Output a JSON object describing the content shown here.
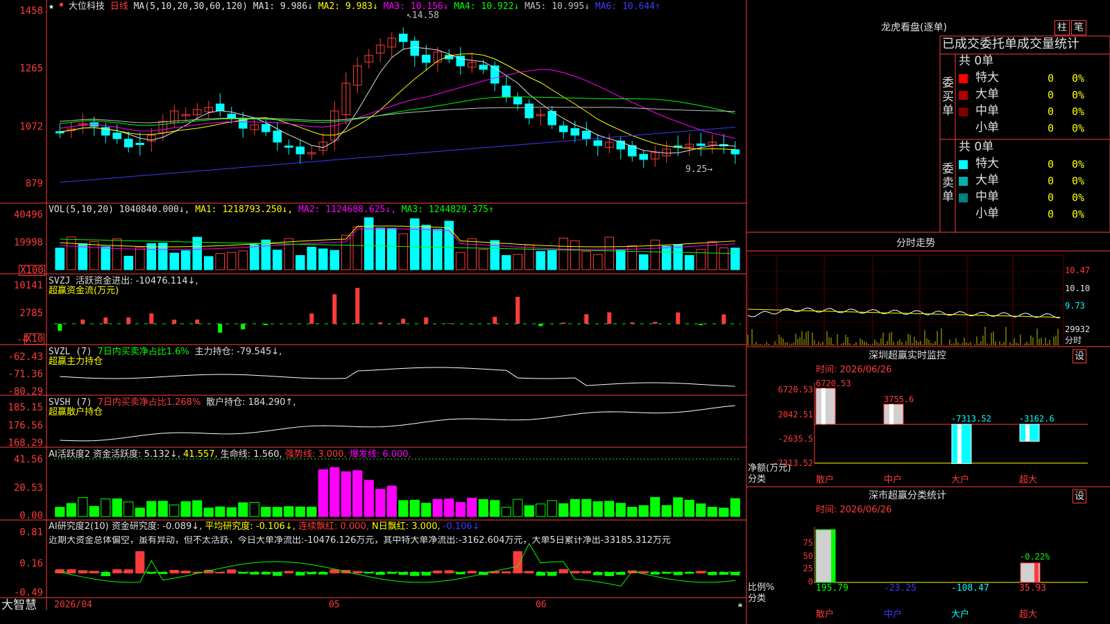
{
  "stock": {
    "name": "大位科技",
    "period": "日线"
  },
  "top_menu": {
    "star": "★",
    "circle": "●"
  },
  "kline": {
    "ma_title": "MA(5,10,20,30,60,120)",
    "ma_values": [
      {
        "label": "MA1: 9.986↓",
        "color": "#e0e0e0"
      },
      {
        "label": "MA2: 9.983↓",
        "color": "#ffff00"
      },
      {
        "label": "MA3: 10.156↓",
        "color": "#ff00ff"
      },
      {
        "label": "MA4: 10.922↓",
        "color": "#00ff00"
      },
      {
        "label": "MA5: 10.995↓",
        "color": "#c0c0c0"
      },
      {
        "label": "MA6: 10.644↑",
        "color": "#3b3bff"
      }
    ],
    "y_ticks": [
      "1458",
      "1265",
      "1072",
      "879"
    ],
    "high_marker": "14.58",
    "low_marker": "9.25"
  },
  "vol": {
    "title": "VOL(5,10,20)",
    "value": "1040840.000↓,",
    "ma1": "MA1: 1218793.250↓,",
    "ma2": "MA2: 1124688.625↓,",
    "ma3": "MA3: 1244829.375↑",
    "y_ticks": [
      "40496",
      "19998"
    ],
    "unit": "X100"
  },
  "svzj": {
    "title": "SVZJ",
    "label": "活跃资金进出: -10476.114↓,",
    "sub": "超赢资金流(万元)",
    "y_ticks": [
      "10141",
      "2785",
      "-4"
    ],
    "unit": "X10"
  },
  "svzl": {
    "title": "SVZL (7)",
    "red": "7日内买卖净占比1.6%",
    "label": "主力持仓: -79.545↓,",
    "sub": "超赢主力持仓",
    "y_ticks": [
      "-62.43",
      "-71.36",
      "-80.29"
    ]
  },
  "svsh": {
    "title": "SVSH (7)",
    "red": "7日内买卖净占比1.268%",
    "label": "散户持仓: 184.290↑,",
    "sub": "超赢散户持仓",
    "y_ticks": [
      "185.15",
      "176.56",
      "168.29"
    ]
  },
  "ai_active": {
    "title": "AI活跃度2 资金活跃度: 5.132↓,",
    "v2": "41.557,",
    "v3": "生命线: 1.560,",
    "v4": "强势线: 3.000,",
    "v5": "爆发线: 6.000,",
    "y_ticks": [
      "41.56",
      "20.53",
      "0.00"
    ]
  },
  "ai_research": {
    "title": "AI研究度2(10) 资金研究度: -0.089↓,",
    "v2": "平均研究度: -0.106↓,",
    "v3": "连续飘红: 0.000,",
    "v4": "N日飘红: 3.000,",
    "v5": "-0.106↓",
    "note": "近期大资金总体偏空，虽有异动，但不太活跃，今日大单净流出:-10476.126万元，其中特大单净流出:-3162.604万元，大单5日累计净出-33185.312万元",
    "y_ticks": [
      "0.81",
      "0.16",
      "-0.49"
    ]
  },
  "bottom": {
    "brand": "大智慧",
    "date": "2026/04",
    "m05": "05",
    "m06": "06"
  },
  "dragon": {
    "title": "龙虎看盘(逐单)",
    "tabs": [
      "柱",
      "笔"
    ],
    "header": "已成交委托单成交量统计",
    "buy_label": "委买单",
    "sell_label": "委卖单",
    "buy_total": "共 0单",
    "sell_total": "共 0单",
    "buy_rows": [
      {
        "name": "特大",
        "val": "0",
        "pct": "0%",
        "color": "#ff0000"
      },
      {
        "name": "大单",
        "val": "0",
        "pct": "0%",
        "color": "#b00000"
      },
      {
        "name": "中单",
        "val": "0",
        "pct": "0%",
        "color": "#800000"
      },
      {
        "name": "小单",
        "val": "0",
        "pct": "0%",
        "color": "#000000"
      }
    ],
    "sell_rows": [
      {
        "name": "特大",
        "val": "0",
        "pct": "0%",
        "color": "#00ffff"
      },
      {
        "name": "大单",
        "val": "0",
        "pct": "0%",
        "color": "#00b0b0"
      },
      {
        "name": "中单",
        "val": "0",
        "pct": "0%",
        "color": "#008080"
      },
      {
        "name": "小单",
        "val": "0",
        "pct": "0%",
        "color": "#000000"
      }
    ]
  },
  "intraday": {
    "title": "分时走势",
    "ticks": [
      "10.47",
      "10.10",
      "9.73",
      "29932",
      "分时"
    ]
  },
  "monitor": {
    "title": "深圳超赢实时监控",
    "set": "设",
    "time": "时间: 2026/06/26",
    "y_ticks": [
      "6720.53",
      "2042.51",
      "-2635.5",
      "-7313.52"
    ],
    "ylabel": "净额(万元)",
    "xlabel": "分类",
    "categories": [
      "散户",
      "中户",
      "大户",
      "超大"
    ],
    "values": [
      6720.53,
      3755.6,
      -7313.52,
      -3162.6
    ],
    "value_labels": [
      "6720.53",
      "3755.6",
      "-7313.52",
      "-3162.6"
    ]
  },
  "classify": {
    "title": "深市超赢分类统计",
    "set": "设",
    "time": "时间: 2026/06/26",
    "y_ticks": [
      "75",
      "50",
      "25",
      "0"
    ],
    "ylabel": "比例%",
    "xlabel": "分类",
    "categories": [
      "散户",
      "中户",
      "大户",
      "超大"
    ],
    "value_labels": [
      "195.79",
      "-23.25",
      "-108.47",
      "35.93"
    ],
    "top_label": "-0.22%"
  },
  "chart_data": [
    {
      "type": "candlestick",
      "title": "大位科技 日线",
      "ylim": [
        879,
        1458
      ],
      "y_ticks": [
        1458,
        1265,
        1072,
        879
      ],
      "x_labels": [
        "2026/04",
        "05",
        "06"
      ],
      "annotations": [
        "14.58",
        "9.25"
      ]
    },
    {
      "type": "bar",
      "title": "监控 净额(万元)",
      "categories": [
        "散户",
        "中户",
        "大户",
        "超大"
      ],
      "values": [
        6720.53,
        3755.6,
        -7313.52,
        -3162.6
      ]
    },
    {
      "type": "bar",
      "title": "分类 比例%",
      "categories": [
        "散户",
        "中户",
        "大户",
        "超大"
      ],
      "values": [
        195.79,
        -23.25,
        -108.47,
        35.93
      ]
    }
  ]
}
